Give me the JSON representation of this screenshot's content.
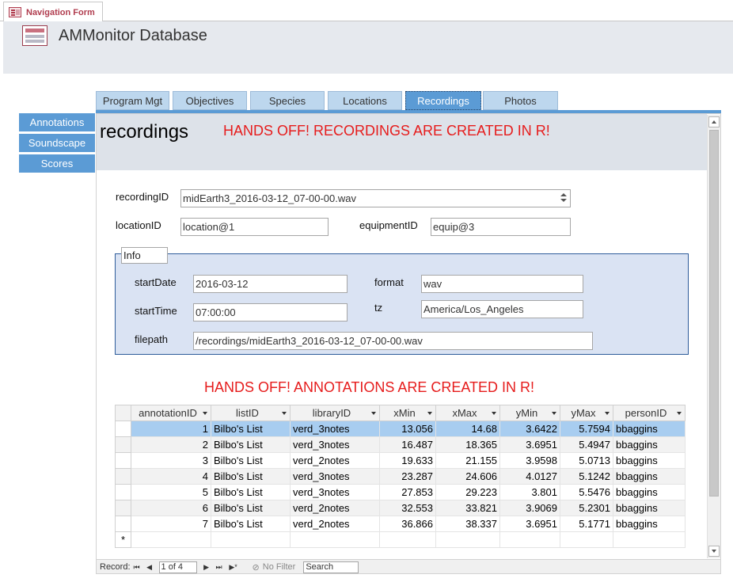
{
  "document_tab": {
    "label": "Navigation Form",
    "icon": "form-icon"
  },
  "header": {
    "title": "AMMonitor Database",
    "icon": "form-icon"
  },
  "nav_tabs": [
    {
      "label": "Program Mgt",
      "active": false
    },
    {
      "label": "Objectives",
      "active": false
    },
    {
      "label": "Species",
      "active": false
    },
    {
      "label": "Locations",
      "active": false
    },
    {
      "label": "Recordings",
      "active": true
    },
    {
      "label": "Photos",
      "active": false
    }
  ],
  "side_buttons": [
    {
      "label": "Annotations"
    },
    {
      "label": "Soundscape"
    },
    {
      "label": "Scores"
    }
  ],
  "form": {
    "title": "recordings",
    "warning_top": "HANDS OFF!  RECORDINGS ARE CREATED IN R!",
    "recordingID": {
      "label": "recordingID",
      "value": "midEarth3_2016-03-12_07-00-00.wav"
    },
    "locationID": {
      "label": "locationID",
      "value": "location@1"
    },
    "equipmentID": {
      "label": "equipmentID",
      "value": "equip@3"
    },
    "info": {
      "label": "Info",
      "startDate": {
        "label": "startDate",
        "value": "2016-03-12"
      },
      "format": {
        "label": "format",
        "value": "wav"
      },
      "startTime": {
        "label": "startTime",
        "value": "07:00:00"
      },
      "tz": {
        "label": "tz",
        "value": "America/Los_Angeles"
      },
      "filepath": {
        "label": "filepath",
        "value": "/recordings/midEarth3_2016-03-12_07-00-00.wav"
      }
    },
    "warning_annotations": "HANDS OFF!  ANNOTATIONS ARE CREATED IN R!"
  },
  "annotations_table": {
    "columns": [
      "annotationID",
      "listID",
      "libraryID",
      "xMin",
      "xMax",
      "yMin",
      "yMax",
      "personID"
    ],
    "rows": [
      [
        "1",
        "Bilbo's List",
        "verd_3notes",
        "13.056",
        "14.68",
        "3.6422",
        "5.7594",
        "bbaggins"
      ],
      [
        "2",
        "Bilbo's List",
        "verd_3notes",
        "16.487",
        "18.365",
        "3.6951",
        "5.4947",
        "bbaggins"
      ],
      [
        "3",
        "Bilbo's List",
        "verd_2notes",
        "19.633",
        "21.155",
        "3.9598",
        "5.0713",
        "bbaggins"
      ],
      [
        "4",
        "Bilbo's List",
        "verd_3notes",
        "23.287",
        "24.606",
        "4.0127",
        "5.1242",
        "bbaggins"
      ],
      [
        "5",
        "Bilbo's List",
        "verd_3notes",
        "27.853",
        "29.223",
        "3.801",
        "5.5476",
        "bbaggins"
      ],
      [
        "6",
        "Bilbo's List",
        "verd_2notes",
        "32.553",
        "33.821",
        "3.9069",
        "5.2301",
        "bbaggins"
      ],
      [
        "7",
        "Bilbo's List",
        "verd_2notes",
        "36.866",
        "38.337",
        "3.6951",
        "5.1771",
        "bbaggins"
      ]
    ],
    "new_row_marker": "*"
  },
  "record_nav": {
    "label": "Record:",
    "position": "1 of 4",
    "first": "⏮",
    "prev": "◀",
    "next": "▶",
    "last": "⏭",
    "new": "▶*",
    "filter": "No Filter",
    "search": "Search"
  },
  "colors": {
    "accent": "#5b9bd5",
    "tab_inactive": "#bdd7ee",
    "warning": "#e61c1c",
    "info_bg": "#dae3f3",
    "selected_row": "#a8cdf0",
    "brand": "#b03c4e"
  }
}
